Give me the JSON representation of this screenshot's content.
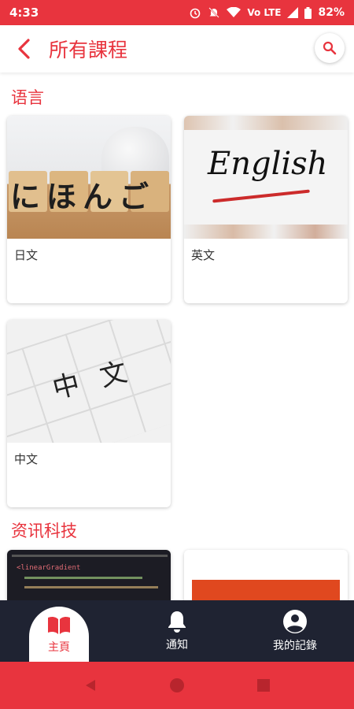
{
  "status": {
    "time": "4:33",
    "network": "Vo LTE",
    "battery": "82%"
  },
  "header": {
    "title": "所有課程",
    "back_icon": "back-arrow-icon",
    "search_icon": "search-icon"
  },
  "sections": [
    {
      "title": "语言",
      "courses": [
        {
          "label": "日文",
          "image_text": "にほんご"
        },
        {
          "label": "英文",
          "image_text": "English"
        },
        {
          "label": "中文",
          "image_text": "中文"
        }
      ]
    },
    {
      "title": "资讯科技",
      "courses": [
        {
          "label": "",
          "image_text": "<linearGradient"
        },
        {
          "label": "",
          "image_text": ""
        }
      ]
    }
  ],
  "bottom_nav": [
    {
      "label": "主頁",
      "icon": "book-icon",
      "active": true
    },
    {
      "label": "通知",
      "icon": "bell-icon",
      "active": false
    },
    {
      "label": "我的記錄",
      "icon": "account-icon",
      "active": false
    }
  ],
  "colors": {
    "accent": "#e8343e",
    "nav_bg": "#1f2332"
  }
}
